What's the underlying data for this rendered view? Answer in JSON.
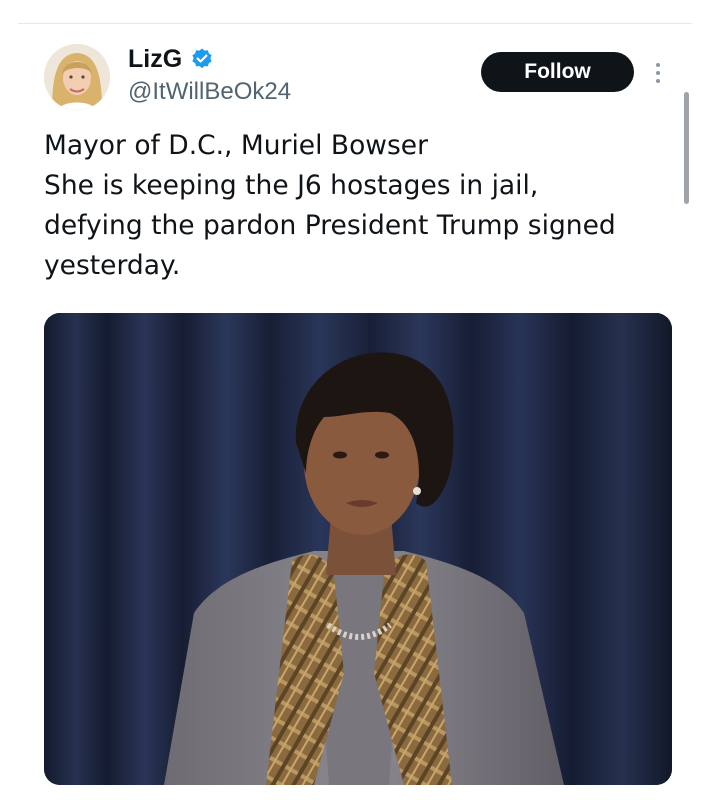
{
  "tweet": {
    "author": {
      "display_name": "LizG",
      "handle": "@ItWillBeOk24",
      "verified": true
    },
    "follow_label": "Follow",
    "text_lines": [
      "Mayor of D.C., Muriel Bowser",
      "She is keeping the J6 hostages in jail,",
      "defying the pardon President Trump signed",
      "yesterday."
    ]
  },
  "colors": {
    "text_primary": "#0f1419",
    "text_secondary": "#536471",
    "verified_blue": "#1d9bf0",
    "follow_bg": "#0f1419",
    "curtain": "#1a2136"
  },
  "icons": {
    "verified": "verified-badge-icon",
    "more": "more-dots-icon"
  }
}
